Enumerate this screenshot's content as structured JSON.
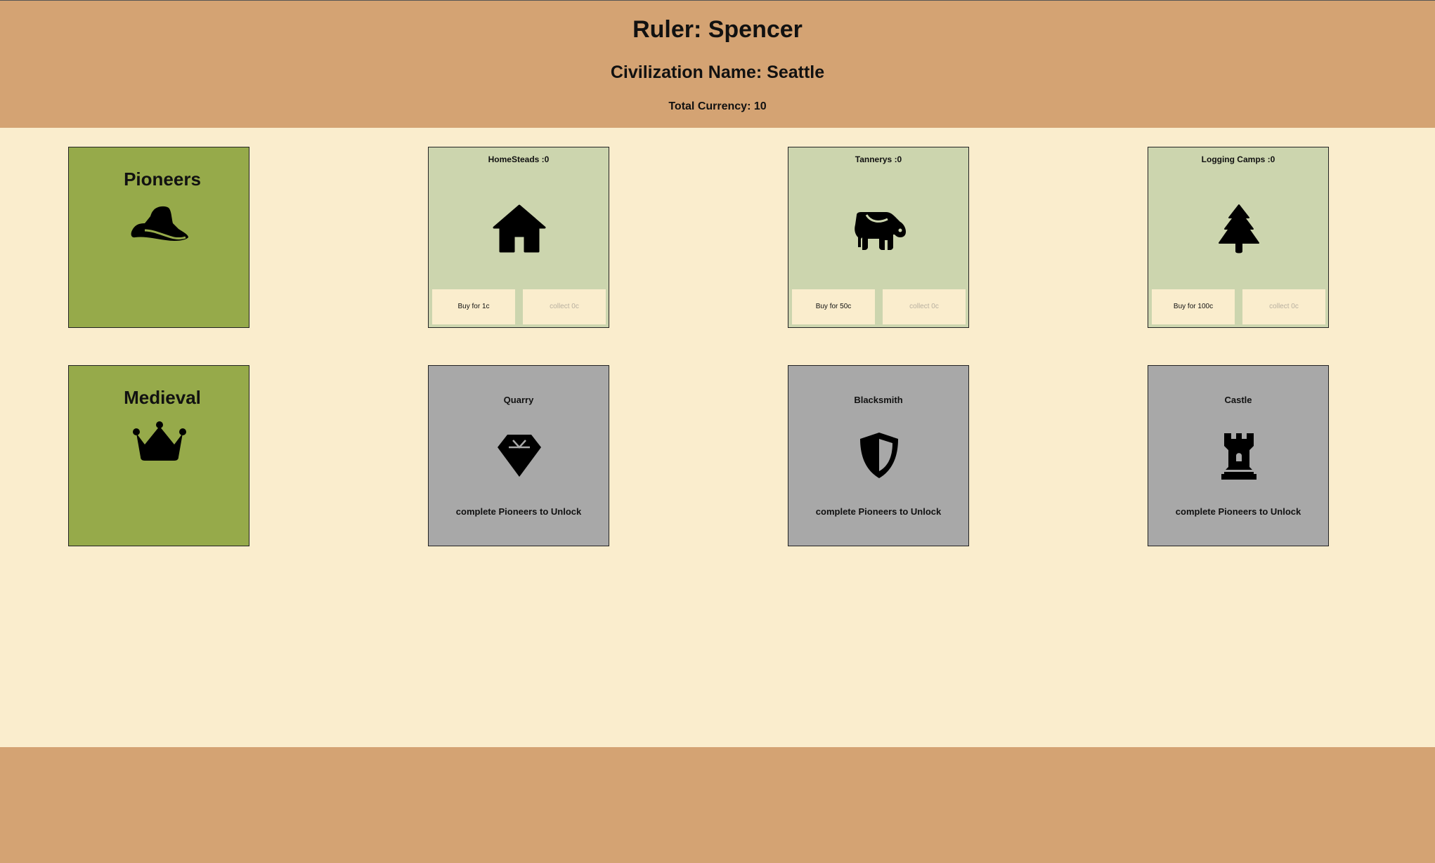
{
  "header": {
    "ruler": "Ruler: Spencer",
    "civilization": "Civilization Name: Seattle",
    "currency": "Total Currency: 10"
  },
  "eras": [
    {
      "title": "Pioneers",
      "icon": "cowboy-hat-icon"
    },
    {
      "title": "Medieval",
      "icon": "crown-icon"
    }
  ],
  "buildings": [
    {
      "title": "HomeSteads :0",
      "icon": "house-icon",
      "buy_label": "Buy for 1c",
      "collect_label": "collect 0c"
    },
    {
      "title": "Tannerys :0",
      "icon": "cow-icon",
      "buy_label": "Buy for 50c",
      "collect_label": "collect 0c"
    },
    {
      "title": "Logging Camps :0",
      "icon": "tree-icon",
      "buy_label": "Buy for 100c",
      "collect_label": "collect 0c"
    }
  ],
  "locked": [
    {
      "title": "Quarry",
      "icon": "gem-icon",
      "message": "complete Pioneers to Unlock"
    },
    {
      "title": "Blacksmith",
      "icon": "shield-icon",
      "message": "complete Pioneers to Unlock"
    },
    {
      "title": "Castle",
      "icon": "castle-tower-icon",
      "message": "complete Pioneers to Unlock"
    }
  ],
  "colors": {
    "header_bg": "#d4a373",
    "page_bg": "#faedcd",
    "era_card": "#96aa4a",
    "building_card": "#ccd5ae",
    "locked_card": "#a8a8a8"
  }
}
